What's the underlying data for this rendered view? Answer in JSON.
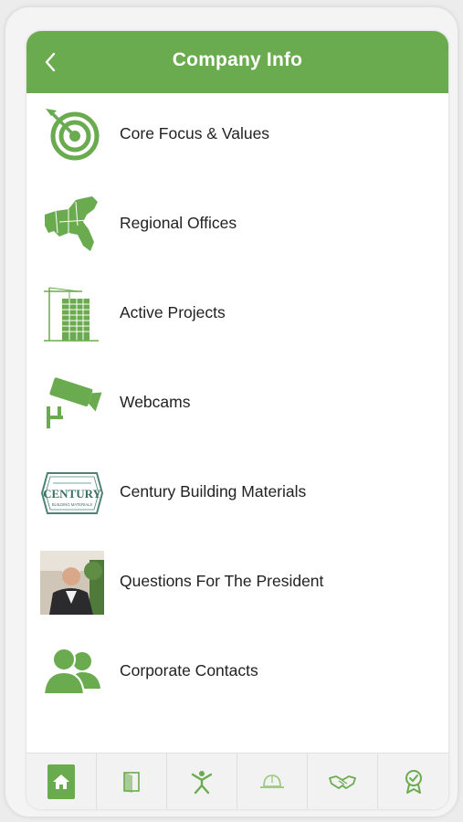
{
  "header": {
    "title": "Company Info",
    "back_icon": "chevron-left-icon"
  },
  "menu": {
    "items": [
      {
        "label": "Core Focus & Values",
        "icon": "target-icon"
      },
      {
        "label": "Regional Offices",
        "icon": "regional-map-icon"
      },
      {
        "label": "Active Projects",
        "icon": "construction-crane-icon"
      },
      {
        "label": "Webcams",
        "icon": "security-camera-icon"
      },
      {
        "label": "Century Building Materials",
        "icon": "century-logo"
      },
      {
        "label": "Questions For The President",
        "icon": "president-photo"
      },
      {
        "label": "Corporate Contacts",
        "icon": "people-icon"
      }
    ],
    "century_logo_text": "CENTURY",
    "century_logo_subtext": "BUILDING MATERIALS"
  },
  "tabbar": {
    "tabs": [
      {
        "icon": "home-icon",
        "active": true
      },
      {
        "icon": "door-icon",
        "active": false
      },
      {
        "icon": "person-icon",
        "active": false
      },
      {
        "icon": "hard-hat-icon",
        "active": false
      },
      {
        "icon": "handshake-icon",
        "active": false
      },
      {
        "icon": "award-badge-icon",
        "active": false
      }
    ]
  },
  "colors": {
    "accent": "#6bab4f",
    "text": "#222222",
    "tabbar_bg": "#f2f2f2"
  }
}
